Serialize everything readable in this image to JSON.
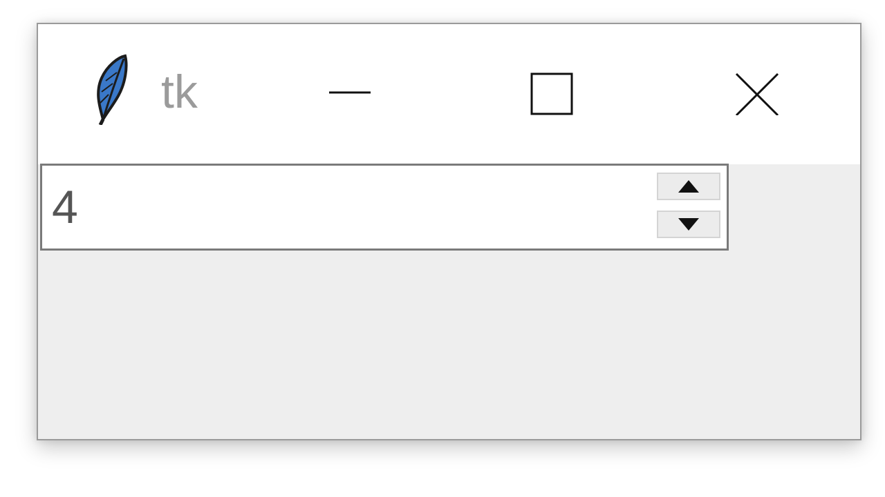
{
  "window": {
    "title": "tk",
    "icon": "tk-feather-icon",
    "controls": {
      "minimize": "minimize-icon",
      "maximize": "maximize-icon",
      "close": "close-icon"
    }
  },
  "spinbox": {
    "value": "4",
    "up_icon": "triangle-up-icon",
    "down_icon": "triangle-down-icon"
  },
  "colors": {
    "titlebar": "#ffffff",
    "client_area": "#eeeeee",
    "feather": "#3a78c8",
    "title_text": "#9b9b9b"
  }
}
